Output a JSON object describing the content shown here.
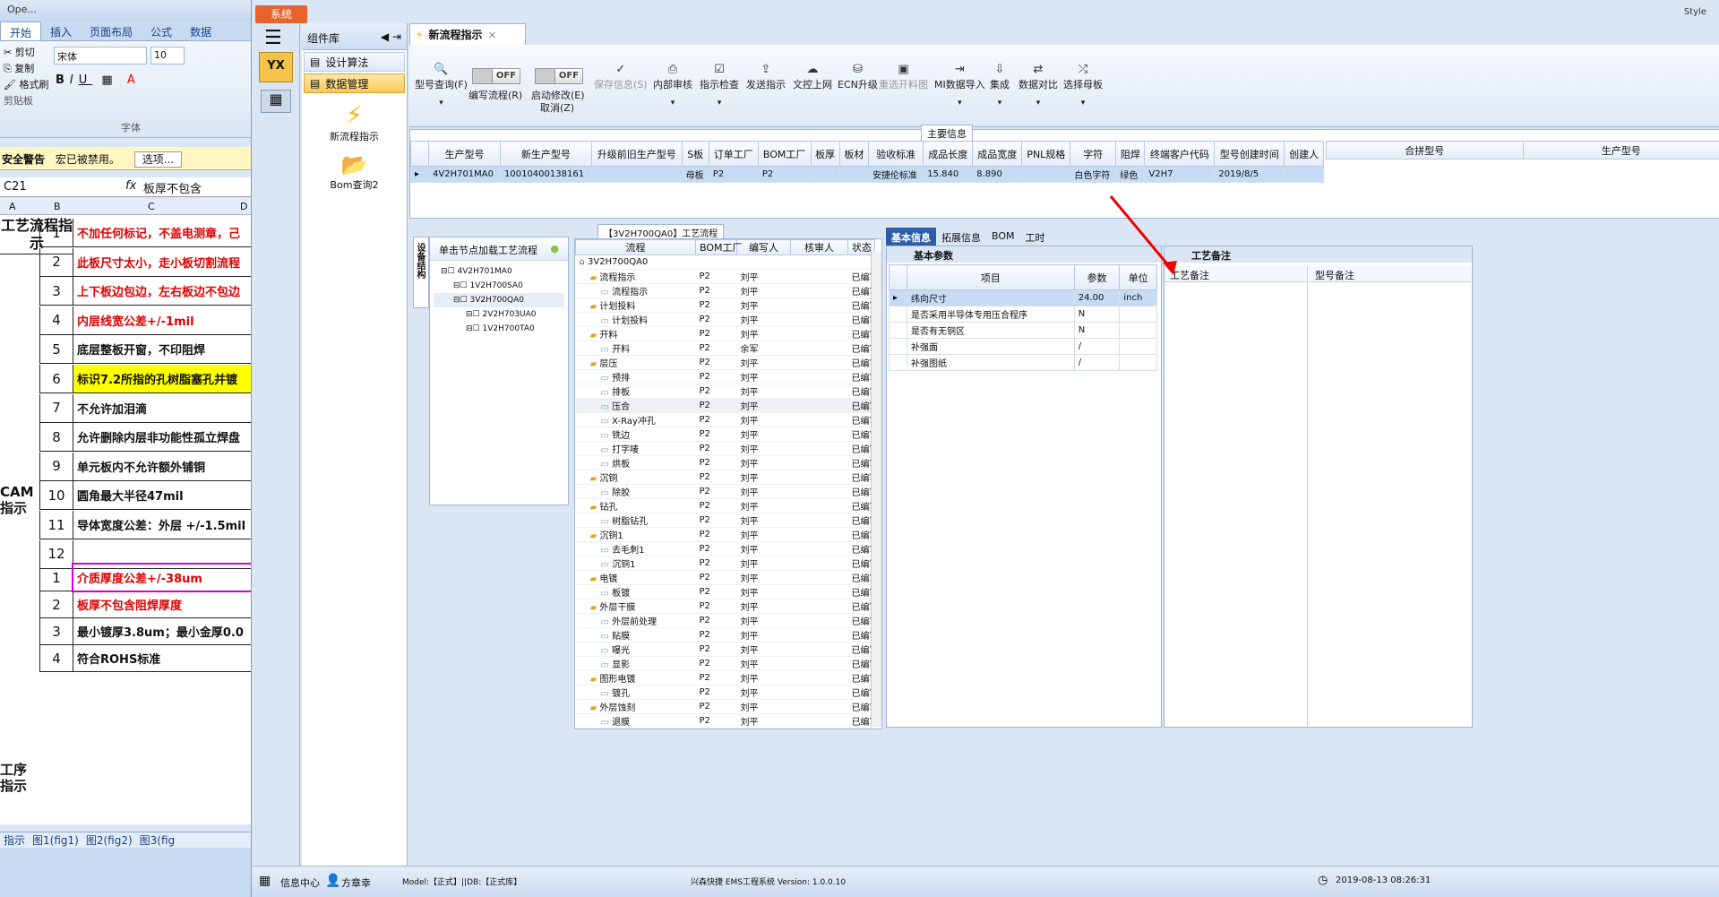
{
  "excel": {
    "title": "Ope...",
    "tabs": [
      "开始",
      "插入",
      "页面布局",
      "公式",
      "数据"
    ],
    "clipboard": {
      "cut": "剪切",
      "copy": "复制",
      "format_painter": "格式刷",
      "group": "剪贴板"
    },
    "font": {
      "name": "宋体",
      "size": "10",
      "group": "字体"
    },
    "warning": {
      "title": "安全警告",
      "message": "宏已被禁用。",
      "button": "选项..."
    },
    "namebox": "C21",
    "formula": "板厚不包含",
    "columns": [
      "A",
      "B",
      "C",
      "D"
    ],
    "header_cell": "工艺流程指示",
    "section_cam": "CAM指示",
    "section_proc": "工序指示",
    "rows_cam": [
      {
        "n": "1",
        "text": "不加任何标记，不盖电测章，己",
        "color": "red"
      },
      {
        "n": "2",
        "text": "此板尺寸太小，走小板切割流程",
        "color": "red"
      },
      {
        "n": "3",
        "text": "上下板边包边，左右板边不包边",
        "color": "red"
      },
      {
        "n": "4",
        "text": "内层线宽公差+/-1mil",
        "color": "red"
      },
      {
        "n": "5",
        "text": "底层整板开窗，不印阻焊",
        "color": "black"
      },
      {
        "n": "6",
        "text": "标识7.2所指的孔树脂塞孔并镀",
        "color": "black",
        "highlight": "yellow"
      },
      {
        "n": "7",
        "text": "不允许加泪滴",
        "color": "black"
      },
      {
        "n": "8",
        "text": "允许删除内层非功能性孤立焊盘",
        "color": "black"
      },
      {
        "n": "9",
        "text": "单元板内不允许额外铺铜",
        "color": "black"
      },
      {
        "n": "10",
        "text": "圆角最大半径47mil",
        "color": "black"
      },
      {
        "n": "11",
        "text": "导体宽度公差：外层 +/-1.5mil",
        "color": "black"
      },
      {
        "n": "12",
        "text": "",
        "color": "black"
      }
    ],
    "rows_proc": [
      {
        "n": "1",
        "text": "介质厚度公差+/-38um",
        "color": "red",
        "boxed": true
      },
      {
        "n": "2",
        "text": "板厚不包含阻焊厚度",
        "color": "red"
      },
      {
        "n": "3",
        "text": "最小镀厚3.8um；最小金厚0.0",
        "color": "black"
      },
      {
        "n": "4",
        "text": "符合ROHS标准",
        "color": "black"
      }
    ],
    "sheets": [
      "指示",
      "图1(fig1)",
      "图2(fig2)",
      "图3(fig"
    ]
  },
  "app": {
    "system_button": "系统",
    "component_panel": {
      "title": "组件库",
      "items": [
        "设计算法",
        "数据管理"
      ],
      "tools": [
        "新流程指示",
        "Bom查询2"
      ]
    },
    "doc_tab": "新流程指示",
    "toolbar": {
      "query": "型号查询(F)",
      "edit_flow": "编写流程(R)",
      "auto_modify": "启动修改(E)",
      "cancel": "取消(Z)",
      "toggle_off": "OFF",
      "save": "保存信息(S)",
      "internal_review": "内部审核",
      "check": "指示检查",
      "send": "发送指示",
      "upload": "文控上网",
      "ecn": "ECN升级",
      "reselect": "重选开料图",
      "mi_import": "MI数据导入",
      "integrate": "集成",
      "compare": "数据对比",
      "choose_mother": "选择母板"
    },
    "main_info": {
      "title": "主要信息",
      "columns": [
        "生产型号",
        "新生产型号",
        "升级前旧生产型号",
        "S板",
        "订单工厂",
        "BOM工厂",
        "板厚",
        "板材",
        "验收标准",
        "成品长度",
        "成品宽度",
        "PNL规格",
        "字符",
        "阻焊",
        "终端客户代码",
        "型号创建时间",
        "创建人"
      ],
      "row": [
        "4V2H701MA0",
        "10010400138161",
        "",
        "母板",
        "P2",
        "P2",
        "",
        "",
        "安捷伦标准",
        "15.840",
        "8.890",
        "",
        "白色字符",
        "绿色",
        "V2H7",
        "2019/8/5",
        ""
      ],
      "side_columns": [
        "合拼型号",
        "生产型号"
      ]
    },
    "tree_panel": {
      "title": "【3V2H700QA0】工艺流程",
      "side_tab": "设备结构",
      "hint": "单击节点加载工艺流程",
      "nodes": [
        "4V2H701MA0",
        "1V2H700SA0",
        "3V2H700QA0",
        "2V2H703UA0",
        "1V2H700TA0"
      ]
    },
    "flow": {
      "columns": [
        "流程",
        "BOM工厂",
        "编写人",
        "核审人",
        "状态"
      ],
      "root": "3V2H700QA0",
      "rows": [
        {
          "name": "流程指示",
          "lvl": 1,
          "f": "P2",
          "w": "刘平",
          "s": "已编写"
        },
        {
          "name": "流程指示",
          "lvl": 2,
          "f": "P2",
          "w": "刘平",
          "s": "已编写"
        },
        {
          "name": "计划投料",
          "lvl": 1,
          "f": "P2",
          "w": "刘平",
          "s": "已编写"
        },
        {
          "name": "计划投料",
          "lvl": 2,
          "f": "P2",
          "w": "刘平",
          "s": "已编写"
        },
        {
          "name": "开料",
          "lvl": 1,
          "f": "P2",
          "w": "刘平",
          "s": "已编写"
        },
        {
          "name": "开料",
          "lvl": 2,
          "f": "P2",
          "w": "余军",
          "s": "已编写"
        },
        {
          "name": "层压",
          "lvl": 1,
          "f": "P2",
          "w": "刘平",
          "s": "已编写"
        },
        {
          "name": "预排",
          "lvl": 2,
          "f": "P2",
          "w": "刘平",
          "s": "已编写"
        },
        {
          "name": "排板",
          "lvl": 2,
          "f": "P2",
          "w": "刘平",
          "s": "已编写"
        },
        {
          "name": "压合",
          "lvl": 2,
          "f": "P2",
          "w": "刘平",
          "s": "已编写"
        },
        {
          "name": "X-Ray冲孔",
          "lvl": 2,
          "f": "P2",
          "w": "刘平",
          "s": "已编写"
        },
        {
          "name": "铣边",
          "lvl": 2,
          "f": "P2",
          "w": "刘平",
          "s": "已编写"
        },
        {
          "name": "打字唛",
          "lvl": 2,
          "f": "P2",
          "w": "刘平",
          "s": "已编写"
        },
        {
          "name": "烘板",
          "lvl": 2,
          "f": "P2",
          "w": "刘平",
          "s": "已编写"
        },
        {
          "name": "沉铜",
          "lvl": 1,
          "f": "P2",
          "w": "刘平",
          "s": "已编写"
        },
        {
          "name": "除胶",
          "lvl": 2,
          "f": "P2",
          "w": "刘平",
          "s": "已编写"
        },
        {
          "name": "钻孔",
          "lvl": 1,
          "f": "P2",
          "w": "刘平",
          "s": "已编写"
        },
        {
          "name": "树脂钻孔",
          "lvl": 2,
          "f": "P2",
          "w": "刘平",
          "s": "已编写"
        },
        {
          "name": "沉铜1",
          "lvl": 1,
          "f": "P2",
          "w": "刘平",
          "s": "已编写"
        },
        {
          "name": "去毛刺1",
          "lvl": 2,
          "f": "P2",
          "w": "刘平",
          "s": "已编写"
        },
        {
          "name": "沉铜1",
          "lvl": 2,
          "f": "P2",
          "w": "刘平",
          "s": "已编写"
        },
        {
          "name": "电镀",
          "lvl": 1,
          "f": "P2",
          "w": "刘平",
          "s": "已编写"
        },
        {
          "name": "板镀",
          "lvl": 2,
          "f": "P2",
          "w": "刘平",
          "s": "已编写"
        },
        {
          "name": "外层干膜",
          "lvl": 1,
          "f": "P2",
          "w": "刘平",
          "s": "已编写"
        },
        {
          "name": "外层前处理",
          "lvl": 2,
          "f": "P2",
          "w": "刘平",
          "s": "已编写"
        },
        {
          "name": "贴膜",
          "lvl": 2,
          "f": "P2",
          "w": "刘平",
          "s": "已编写"
        },
        {
          "name": "曝光",
          "lvl": 2,
          "f": "P2",
          "w": "刘平",
          "s": "已编写"
        },
        {
          "name": "显影",
          "lvl": 2,
          "f": "P2",
          "w": "刘平",
          "s": "已编写"
        },
        {
          "name": "图形电镀",
          "lvl": 1,
          "f": "P2",
          "w": "刘平",
          "s": "已编写"
        },
        {
          "name": "镀孔",
          "lvl": 2,
          "f": "P2",
          "w": "刘平",
          "s": "已编写"
        },
        {
          "name": "外层蚀刻",
          "lvl": 1,
          "f": "P2",
          "w": "刘平",
          "s": "已编写"
        },
        {
          "name": "退膜",
          "lvl": 2,
          "f": "P2",
          "w": "刘平",
          "s": "已编写"
        }
      ]
    },
    "info_tabs": [
      "基本信息",
      "拓展信息",
      "BOM",
      "工时"
    ],
    "basic_params": {
      "tab": "基本参数",
      "columns": [
        "项目",
        "参数",
        "单位"
      ],
      "rows": [
        [
          "纬向尺寸",
          "24.00",
          "inch"
        ],
        [
          "是否采用半导体专用压合程序",
          "N",
          ""
        ],
        [
          "是否有无铜区",
          "N",
          ""
        ],
        [
          "补强面",
          "/",
          ""
        ],
        [
          "补强图纸",
          "/",
          ""
        ]
      ]
    },
    "process_remarks": {
      "tab": "工艺备注",
      "col1": "工艺备注",
      "col2": "型号备注"
    },
    "status": {
      "info_center": "信息中心",
      "user": "方章幸",
      "model": "Model:【正式】||DB:【正式库】",
      "system": "兴森快捷 EMS工程系统 Version: 1.0.0.10",
      "time": "2019-08-13 08:26:31"
    },
    "style_label": "Style",
    "accent": "#2c5ea8"
  }
}
